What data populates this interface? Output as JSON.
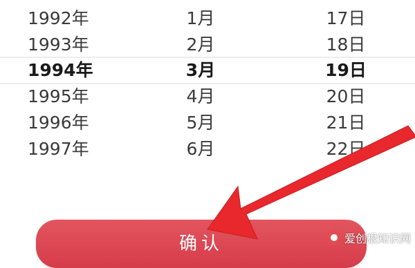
{
  "picker": {
    "rows": [
      {
        "year": "1992年",
        "month": "1月",
        "day": "17日"
      },
      {
        "year": "1993年",
        "month": "2月",
        "day": "18日"
      },
      {
        "year": "1994年",
        "month": "3月",
        "day": "19日"
      },
      {
        "year": "1995年",
        "month": "4月",
        "day": "20日"
      },
      {
        "year": "1996年",
        "month": "5月",
        "day": "21日"
      },
      {
        "year": "1997年",
        "month": "6月",
        "day": "22日"
      }
    ],
    "selected_index": 2
  },
  "confirm": {
    "label": "确认",
    "color": "#dc4752"
  },
  "annotation": {
    "arrow_color": "#e8282d",
    "icon": "arrow-pointer-icon"
  },
  "watermark": {
    "text": "爱创根知识网",
    "icon": "watermark-logo-icon"
  }
}
